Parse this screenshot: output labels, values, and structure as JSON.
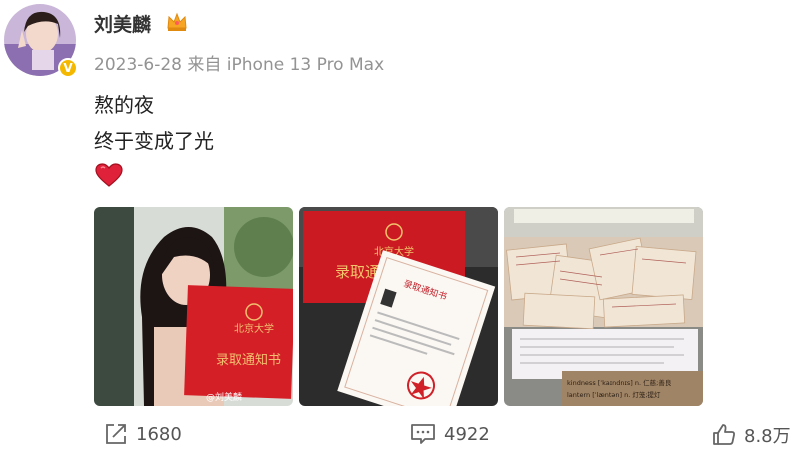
{
  "post": {
    "username": "刘美麟",
    "date": "2023-6-28",
    "source": "来自 iPhone 13 Pro Max",
    "lines": [
      "熬的夜",
      "终于变成了光"
    ],
    "badge": "V"
  },
  "photos": [
    {
      "name": "selfie-with-admission-letter",
      "folder_text": "录取通知书",
      "seal_text": "北京大学",
      "watermark": "@刘美麟"
    },
    {
      "name": "admission-letter-envelope",
      "folder_text": "录取通",
      "letter_title": "录取通知书",
      "seal_text": "北京大学"
    },
    {
      "name": "study-notes-desk",
      "card_line1": "kindness [ˈkaɪndnɪs] n. 仁慈;善良",
      "card_line2": "lantern [ˈlæntən] n. 灯笼;提灯"
    }
  ],
  "actions": {
    "repost_count": "1680",
    "comment_count": "4922",
    "like_count": "8.8万"
  },
  "colors": {
    "accent_red": "#d51f27",
    "verified_gold": "#f5b800",
    "meta_gray": "#939393"
  }
}
